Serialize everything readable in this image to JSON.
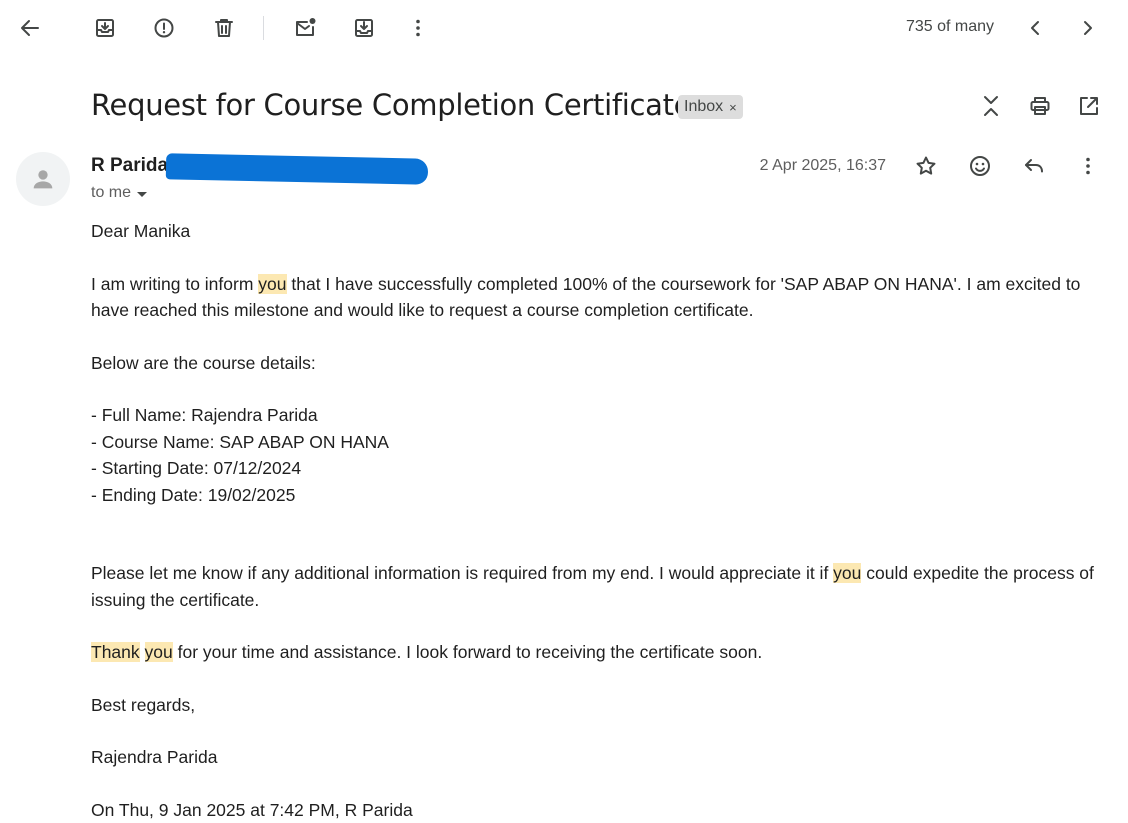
{
  "toolbar": {
    "icons": {
      "back": "arrow-back-icon",
      "archive": "archive-icon",
      "spam": "report-spam-icon",
      "delete": "delete-icon",
      "unread": "mark-unread-icon",
      "move": "move-to-icon",
      "more": "more-vert-icon",
      "older": "chevron-left-icon",
      "newer": "chevron-right-icon"
    },
    "counter": "735 of many"
  },
  "subject": {
    "title": "Request for Course Completion Certificate",
    "label": "Inbox",
    "label_remove": "×",
    "icons": {
      "expand": "expand-collapse-icon",
      "print": "print-icon",
      "open_new": "open-in-new-window-icon"
    }
  },
  "message": {
    "sender_name": "R Parida",
    "recipient": "to me",
    "date": "2 Apr 2025, 16:37",
    "icons": {
      "star": "star-icon",
      "emoji": "add-reaction-icon",
      "reply": "reply-icon",
      "more": "more-vert-icon",
      "avatar": "person-icon"
    },
    "body": {
      "greeting": "Dear Manika",
      "p1_a": "I am writing to inform ",
      "p1_hl": "you",
      "p1_b": " that I have successfully completed 100% of the coursework for 'SAP ABAP ON HANA'. I am excited to have reached this milestone and would like to request a course completion certificate.",
      "details_intro": "Below are the course details:",
      "details": [
        "- Full Name: Rajendra Parida",
        "- Course Name: SAP ABAP ON HANA",
        "- Starting Date: 07/12/2024",
        "- Ending Date: 19/02/2025"
      ],
      "p2_a": "Please let me know if any additional information is required from my end. I would appreciate it if ",
      "p2_hl": "you",
      "p2_b": " could expedite the process of issuing the certificate.",
      "p3_hl1": "Thank",
      "p3_space": " ",
      "p3_hl2": "you",
      "p3_b": " for your time and assistance. I look forward to receiving the certificate soon.",
      "signoff": "Best regards,",
      "signature": "Rajendra Parida",
      "quote_header": "On Thu, 9 Jan 2025 at 7:42 PM, R Parida"
    }
  },
  "colors": {
    "highlight": "#fce8b2",
    "redaction": "#0b73d6",
    "chip_bg": "#dddddd",
    "icon": "#444746"
  }
}
